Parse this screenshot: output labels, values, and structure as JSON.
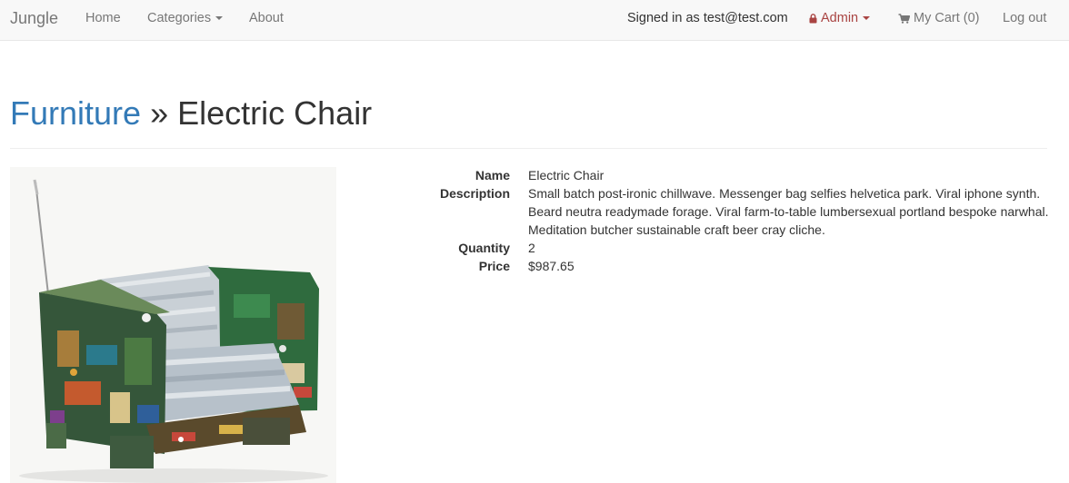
{
  "nav": {
    "brand": "Jungle",
    "home": "Home",
    "categories": "Categories",
    "about": "About",
    "signed_in": "Signed in as test@test.com",
    "admin": "Admin",
    "cart": "My Cart (0)",
    "logout": "Log out"
  },
  "breadcrumb": {
    "category": "Furniture",
    "separator": "»",
    "product": "Electric Chair"
  },
  "product": {
    "image_icon": "electronic-scrap-armchair",
    "details": [
      {
        "label": "Name",
        "value": "Electric Chair"
      },
      {
        "label": "Description",
        "value": "Small batch post-ironic chillwave. Messenger bag selfies helvetica park. Viral iphone synth. Beard neutra readymade forage. Viral farm-to-table lumbersexual portland bespoke narwhal. Meditation butcher sustainable craft beer cray cliche."
      },
      {
        "label": "Quantity",
        "value": "2"
      },
      {
        "label": "Price",
        "value": "$987.65"
      }
    ]
  },
  "colors": {
    "link": "#337ab7",
    "admin": "#a94442",
    "navbar_bg": "#f8f8f8",
    "text": "#333333",
    "nav_text": "#777777"
  }
}
